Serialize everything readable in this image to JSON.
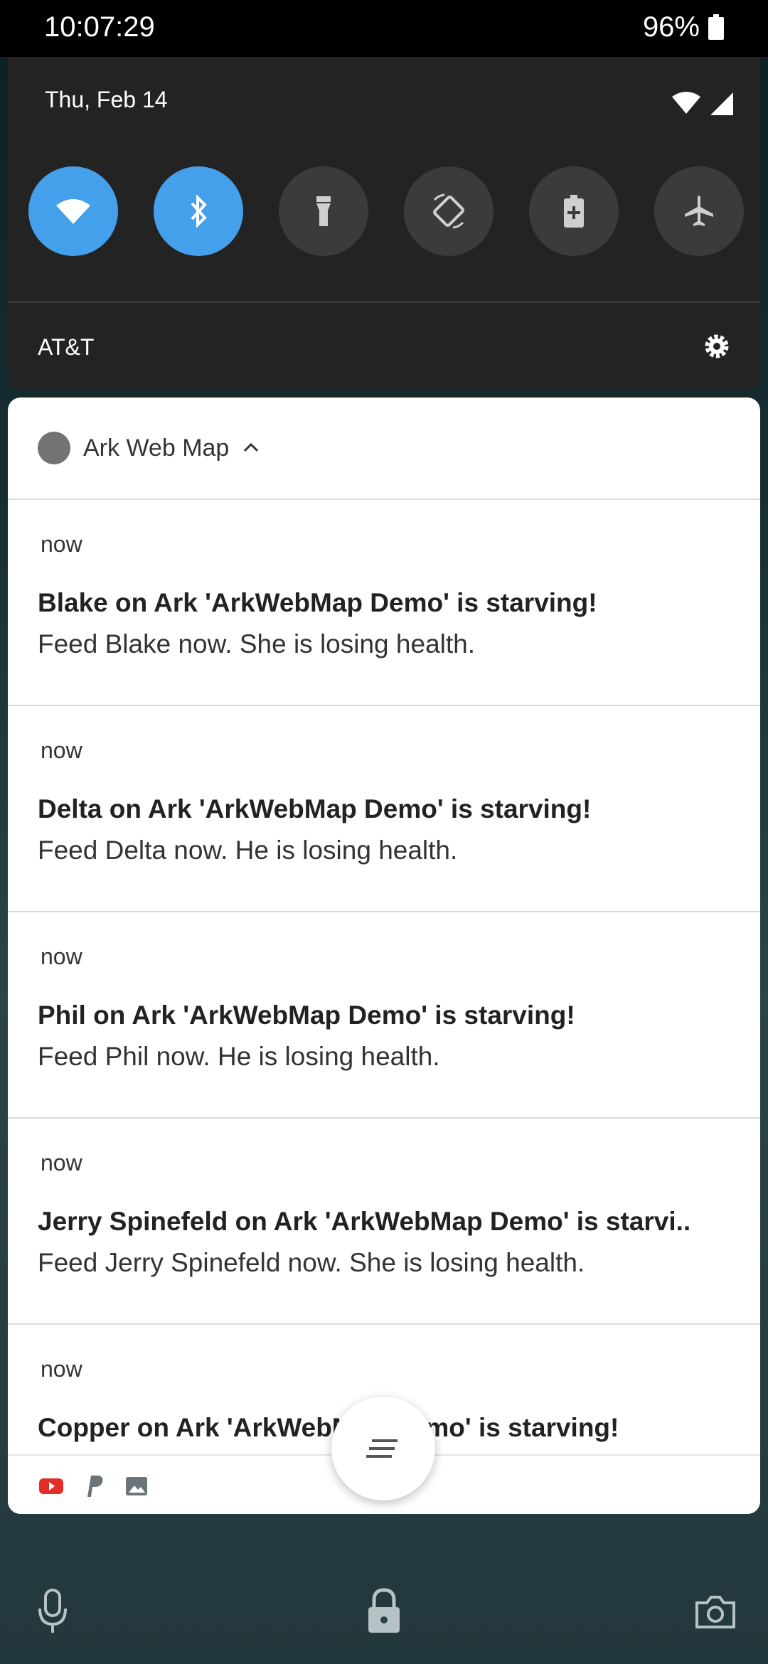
{
  "status_bar": {
    "time": "10:07:29",
    "battery": "96%"
  },
  "quick_settings": {
    "date": "Thu, Feb 14",
    "carrier": "AT&T",
    "tiles": [
      {
        "name": "wifi",
        "on": true
      },
      {
        "name": "bluetooth",
        "on": true
      },
      {
        "name": "flashlight",
        "on": false
      },
      {
        "name": "auto-rotate",
        "on": false
      },
      {
        "name": "battery-saver",
        "on": false
      },
      {
        "name": "airplane-mode",
        "on": false
      }
    ]
  },
  "notification_group": {
    "app_name": "Ark Web Map",
    "items": [
      {
        "time": "now",
        "title": "Blake on Ark 'ArkWebMap Demo' is starving!",
        "body": "Feed Blake now. She is losing health."
      },
      {
        "time": "now",
        "title": "Delta on Ark 'ArkWebMap Demo' is starving!",
        "body": "Feed Delta now. He is losing health."
      },
      {
        "time": "now",
        "title": "Phil on Ark 'ArkWebMap Demo' is starving!",
        "body": "Feed Phil now. He is losing health."
      },
      {
        "time": "now",
        "title": "Jerry Spinefeld on Ark 'ArkWebMap Demo' is starvi..",
        "body": "Feed Jerry Spinefeld now. She is losing health."
      },
      {
        "time": "now",
        "title": "Copper on Ark 'ArkWebMap Demo' is starving!",
        "body": ""
      }
    ],
    "bottom_icons": [
      "youtube-icon",
      "paypal-icon",
      "image-icon"
    ]
  },
  "colors": {
    "tile_on": "#45a0ec",
    "tile_off": "#3b3b3b",
    "panel": "#ffffff",
    "youtube": "#e52d27",
    "paypal": "#6b7478"
  }
}
